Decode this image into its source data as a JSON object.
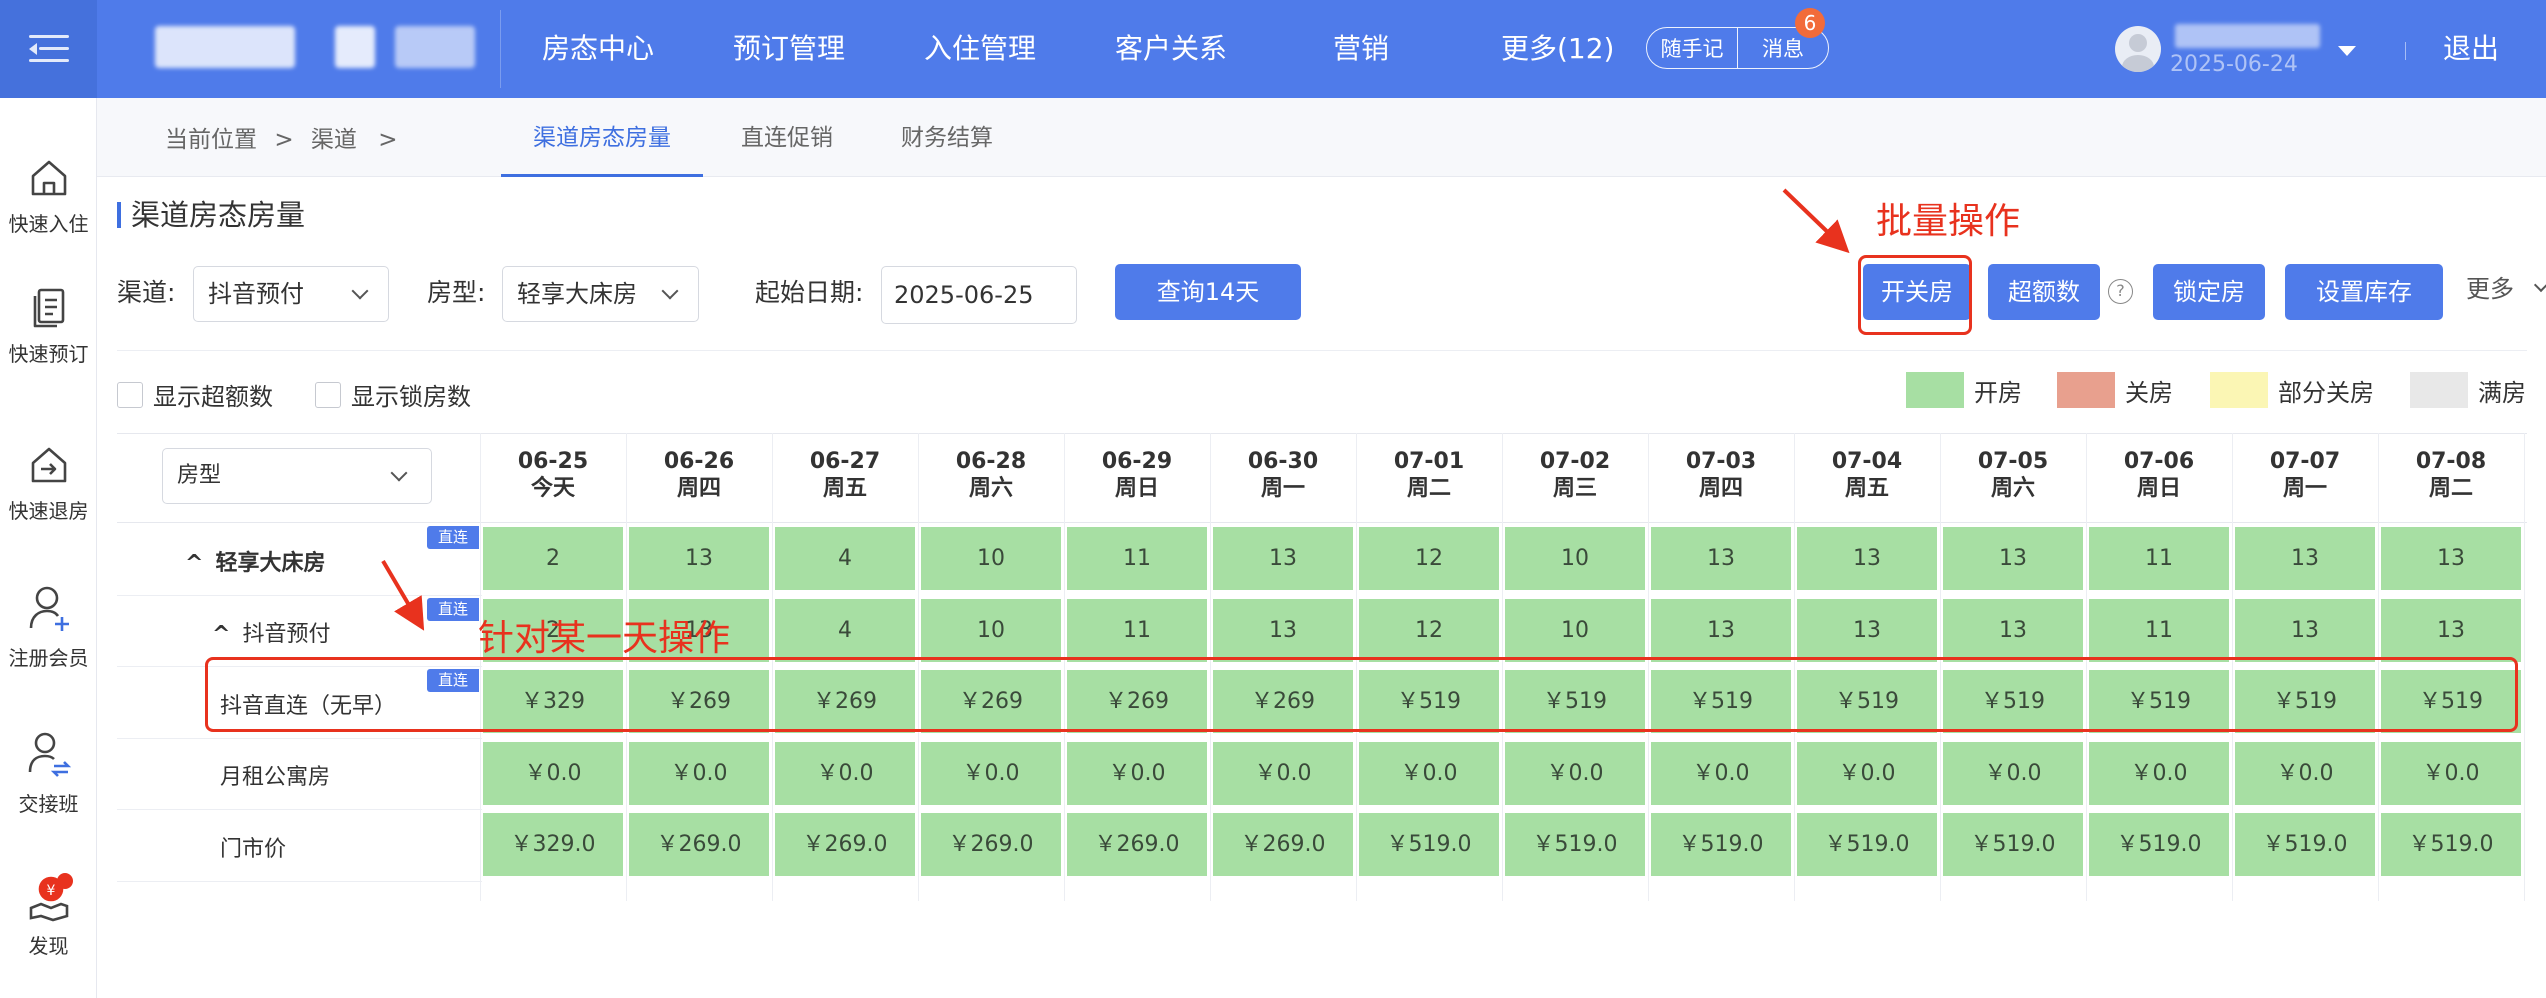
{
  "header": {
    "nav": [
      "房态中心",
      "预订管理",
      "入住管理",
      "客户关系",
      "营销",
      "更多(12)"
    ],
    "notes_label": "随手记",
    "messages_label": "消息",
    "message_count": "6",
    "user_date": "2025-06-24",
    "logout_label": "退出"
  },
  "sidebar": {
    "items": [
      {
        "label": "快速入住",
        "icon": "home-icon"
      },
      {
        "label": "快速预订",
        "icon": "document-icon"
      },
      {
        "label": "快速退房",
        "icon": "checkout-house-icon"
      },
      {
        "label": "注册会员",
        "icon": "add-user-icon"
      },
      {
        "label": "交接班",
        "icon": "shift-handover-icon"
      },
      {
        "label": "发现",
        "icon": "discover-yen-icon"
      }
    ]
  },
  "breadcrumb": {
    "prefix": "当前位置",
    "sep": ">",
    "item": "渠道",
    "sep2": ">"
  },
  "tabs": [
    {
      "label": "渠道房态房量",
      "active": true
    },
    {
      "label": "直连促销",
      "active": false
    },
    {
      "label": "财务结算",
      "active": false
    }
  ],
  "section_title": "渠道房态房量",
  "filters": {
    "channel_label": "渠道:",
    "channel_value": "抖音预付",
    "room_type_label": "房型:",
    "room_type_value": "轻享大床房",
    "start_date_label": "起始日期:",
    "start_date_value": "2025-06-25",
    "query_button": "查询14天"
  },
  "actions": {
    "open_close": "开关房",
    "over_quota": "超额数",
    "help": "?",
    "lock_room": "锁定房",
    "set_inventory": "设置库存",
    "more": "更多"
  },
  "options": {
    "show_over_quota": "显示超额数",
    "show_locked": "显示锁房数"
  },
  "legend": [
    {
      "label": "开房",
      "color": "#a7dfa3"
    },
    {
      "label": "关房",
      "color": "#e8a08e"
    },
    {
      "label": "部分关房",
      "color": "#fbf6b4"
    },
    {
      "label": "满房",
      "color": "#e8e8e8"
    }
  ],
  "table": {
    "room_type_placeholder": "房型",
    "direct_tag": "直连",
    "dates": [
      {
        "date": "06-25",
        "weekday": "今天"
      },
      {
        "date": "06-26",
        "weekday": "周四"
      },
      {
        "date": "06-27",
        "weekday": "周五"
      },
      {
        "date": "06-28",
        "weekday": "周六"
      },
      {
        "date": "06-29",
        "weekday": "周日"
      },
      {
        "date": "06-30",
        "weekday": "周一"
      },
      {
        "date": "07-01",
        "weekday": "周二"
      },
      {
        "date": "07-02",
        "weekday": "周三"
      },
      {
        "date": "07-03",
        "weekday": "周四"
      },
      {
        "date": "07-04",
        "weekday": "周五"
      },
      {
        "date": "07-05",
        "weekday": "周六"
      },
      {
        "date": "07-06",
        "weekday": "周日"
      },
      {
        "date": "07-07",
        "weekday": "周一"
      },
      {
        "date": "07-08",
        "weekday": "周二"
      }
    ],
    "rows": [
      {
        "label": "轻享大床房",
        "expander": "^",
        "direct": true,
        "values": [
          "2",
          "13",
          "4",
          "10",
          "11",
          "13",
          "12",
          "10",
          "13",
          "13",
          "13",
          "11",
          "13",
          "13"
        ]
      },
      {
        "label": "抖音预付",
        "expander": "^",
        "direct": true,
        "values": [
          "2",
          "13",
          "4",
          "10",
          "11",
          "13",
          "12",
          "10",
          "13",
          "13",
          "13",
          "11",
          "13",
          "13"
        ]
      },
      {
        "label": "抖音直连（无早）",
        "direct": true,
        "values": [
          "￥329",
          "￥269",
          "￥269",
          "￥269",
          "￥269",
          "￥269",
          "￥519",
          "￥519",
          "￥519",
          "￥519",
          "￥519",
          "￥519",
          "￥519",
          "￥519"
        ]
      },
      {
        "label": "月租公寓房",
        "direct": false,
        "values": [
          "￥0.0",
          "￥0.0",
          "￥0.0",
          "￥0.0",
          "￥0.0",
          "￥0.0",
          "￥0.0",
          "￥0.0",
          "￥0.0",
          "￥0.0",
          "￥0.0",
          "￥0.0",
          "￥0.0",
          "￥0.0"
        ]
      },
      {
        "label": "门市价",
        "direct": false,
        "values": [
          "￥329.0",
          "￥269.0",
          "￥269.0",
          "￥269.0",
          "￥269.0",
          "￥269.0",
          "￥519.0",
          "￥519.0",
          "￥519.0",
          "￥519.0",
          "￥519.0",
          "￥519.0",
          "￥519.0",
          "￥519.0"
        ]
      }
    ]
  },
  "annotations": {
    "batch": "批量操作",
    "single_day": "针对某一天操作",
    "color": "#e8321e"
  }
}
